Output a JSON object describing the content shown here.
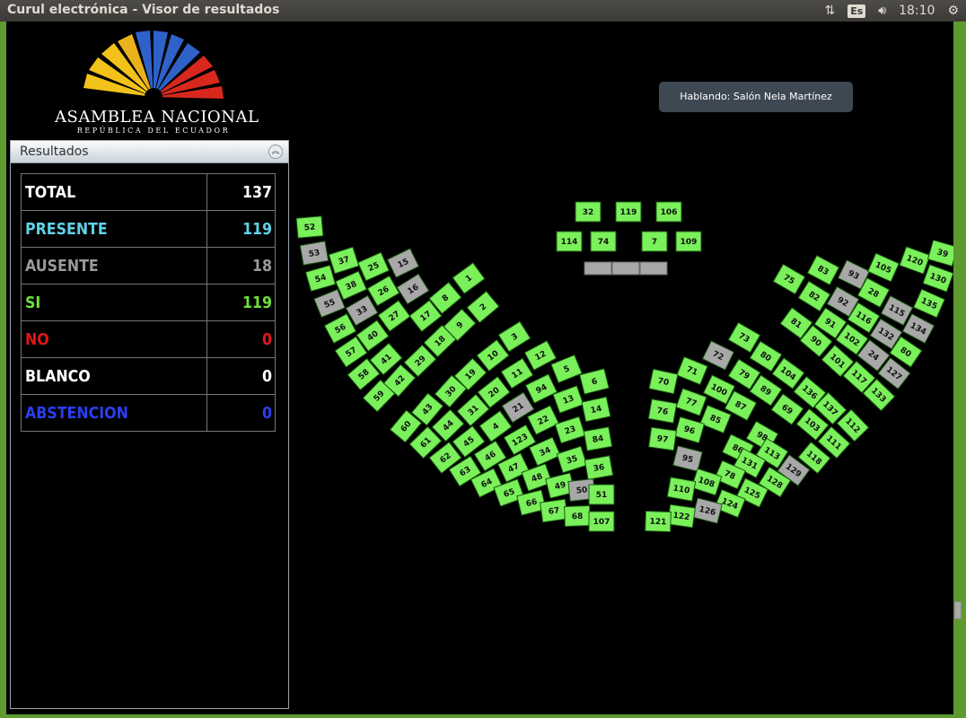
{
  "window": {
    "title": "Curul electrónica - Visor de resultados",
    "tray": {
      "network_icon": "network-arrows-icon",
      "lang": "Es",
      "volume_icon": "volume-icon",
      "clock": "18:10",
      "power_icon": "gear-power-icon"
    }
  },
  "logo": {
    "title": "ASAMBLEA NACIONAL",
    "subtitle": "REPÚBLICA DEL ECUADOR"
  },
  "results": {
    "title": "Resultados",
    "rows": [
      {
        "label": "TOTAL",
        "value": "137",
        "color": "#ffffff"
      },
      {
        "label": "PRESENTE",
        "value": "119",
        "color": "#5fd2e6"
      },
      {
        "label": "AUSENTE",
        "value": "18",
        "color": "#9a9a9a"
      },
      {
        "label": "SI",
        "value": "119",
        "color": "#6de03c"
      },
      {
        "label": "NO",
        "value": "0",
        "color": "#e01818"
      },
      {
        "label": "BLANCO",
        "value": "0",
        "color": "#ffffff"
      },
      {
        "label": "ABSTENCION",
        "value": "0",
        "color": "#2a3ff0"
      }
    ]
  },
  "speaking": "Hablando: Salón Nela Martínez",
  "colors": {
    "present": "#7af05a",
    "absent": "#a8a8a8"
  },
  "seats": {
    "present": [
      "32",
      "119",
      "106",
      "114",
      "74",
      "7",
      "109",
      "52",
      "54",
      "56",
      "57",
      "58",
      "59",
      "37",
      "38",
      "40",
      "41",
      "42",
      "25",
      "26",
      "27",
      "29",
      "17",
      "18",
      "8",
      "9",
      "1",
      "2",
      "3",
      "12",
      "5",
      "6",
      "10",
      "11",
      "94",
      "13",
      "14",
      "19",
      "20",
      "22",
      "23",
      "84",
      "30",
      "31",
      "4",
      "123",
      "34",
      "35",
      "36",
      "43",
      "44",
      "45",
      "46",
      "47",
      "48",
      "49",
      "51",
      "60",
      "61",
      "62",
      "63",
      "64",
      "65",
      "66",
      "67",
      "68",
      "107",
      "75",
      "83",
      "82",
      "81",
      "91",
      "90",
      "102",
      "101",
      "117",
      "116",
      "28",
      "105",
      "120",
      "39",
      "130",
      "135",
      "80",
      "133",
      "73",
      "80",
      "71",
      "70",
      "79",
      "100",
      "77",
      "76",
      "104",
      "89",
      "87",
      "85",
      "96",
      "97",
      "136",
      "69",
      "98",
      "86",
      "137",
      "103",
      "112",
      "111",
      "118",
      "128",
      "125",
      "124",
      "122",
      "121",
      "113",
      "131",
      "78",
      "108",
      "110"
    ],
    "absent": [
      "53",
      "55",
      "33",
      "15",
      "16",
      "21",
      "50",
      "72",
      "95",
      "126",
      "129",
      "93",
      "92",
      "115",
      "132",
      "134",
      "24",
      "127"
    ]
  }
}
